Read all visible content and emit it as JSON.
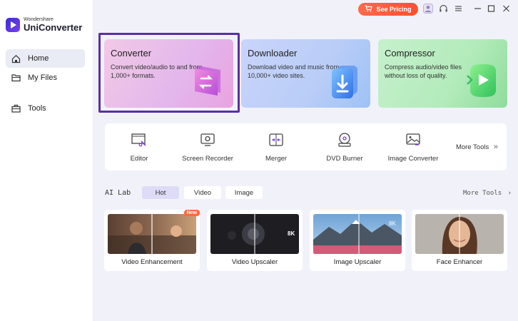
{
  "app": {
    "logo_sub": "Wondershare",
    "logo_main": "UniConverter"
  },
  "topbar": {
    "pricing_label": "See Pricing"
  },
  "sidebar": {
    "items": [
      {
        "label": "Home",
        "icon": "home-icon"
      },
      {
        "label": "My Files",
        "icon": "folder-icon"
      },
      {
        "label": "Tools",
        "icon": "toolbox-icon"
      }
    ]
  },
  "features": [
    {
      "title": "Converter",
      "desc": "Convert video/audio to and from 1,000+ formats.",
      "color": "#e8b6e6"
    },
    {
      "title": "Downloader",
      "desc": "Download video and music from 10,000+ video sites.",
      "color": "#b8cdf6"
    },
    {
      "title": "Compressor",
      "desc": "Compress audio/video files without loss of quality.",
      "color": "#b7ebbf"
    }
  ],
  "tools": [
    {
      "label": "Editor"
    },
    {
      "label": "Screen Recorder"
    },
    {
      "label": "Merger"
    },
    {
      "label": "DVD Burner"
    },
    {
      "label": "Image Converter"
    }
  ],
  "more_tools_label": "More Tools",
  "ailab": {
    "label": "AI Lab",
    "tabs": [
      "Hot",
      "Video",
      "Image"
    ],
    "more_label": "More Tools",
    "cards": [
      {
        "label": "Video Enhancement",
        "badge": "New"
      },
      {
        "label": "Video Upscaler",
        "badge_text": "8K"
      },
      {
        "label": "Image Upscaler",
        "badge_text": "8K"
      },
      {
        "label": "Face Enhancer"
      }
    ]
  }
}
